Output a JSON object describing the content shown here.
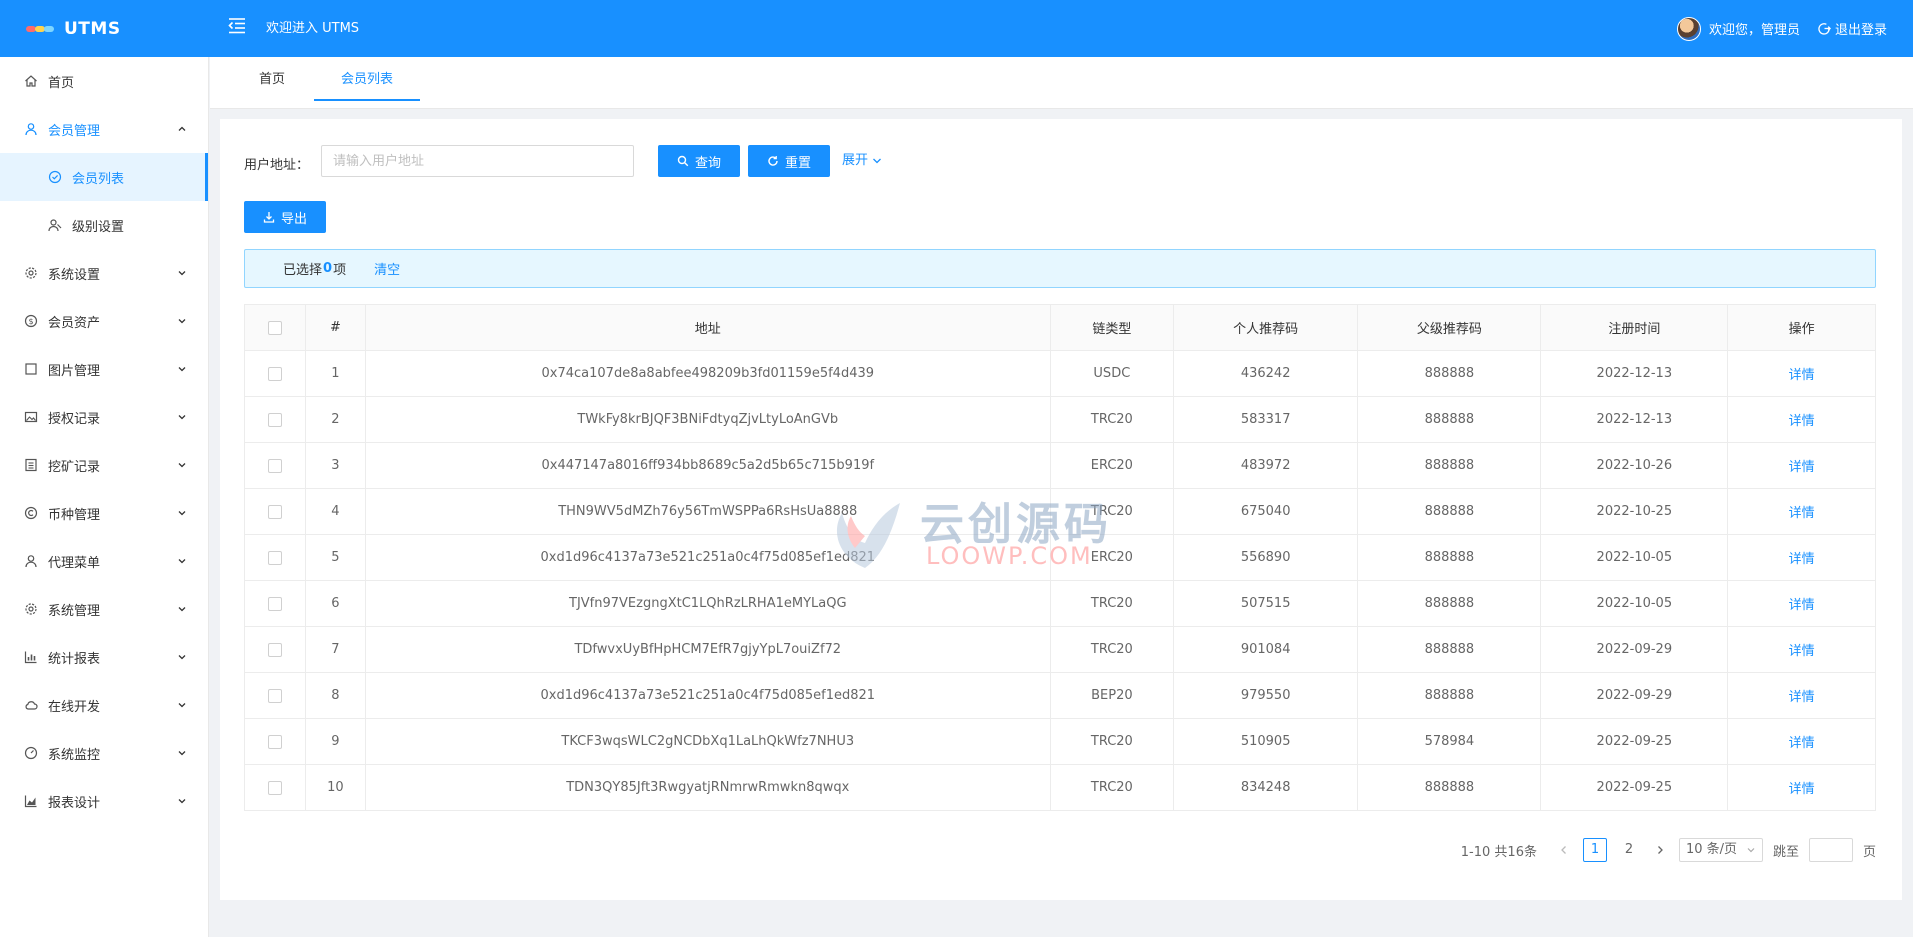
{
  "header": {
    "app_name": "UTMS",
    "welcome": "欢迎进入 UTMS",
    "user_greeting": "欢迎您，管理员",
    "logout": "退出登录",
    "brand_color": "#1890ff"
  },
  "sidebar": {
    "items": [
      {
        "label": "首页",
        "icon": "home-icon"
      },
      {
        "label": "会员管理",
        "icon": "user-icon",
        "open": true
      },
      {
        "label": "会员列表",
        "icon": "circle-check-icon",
        "sub": true,
        "active": true
      },
      {
        "label": "级别设置",
        "icon": "users-icon",
        "sub": true
      },
      {
        "label": "系统设置",
        "icon": "gear-icon"
      },
      {
        "label": "会员资产",
        "icon": "dollar-icon"
      },
      {
        "label": "图片管理",
        "icon": "square-icon"
      },
      {
        "label": "授权记录",
        "icon": "image-icon"
      },
      {
        "label": "挖矿记录",
        "icon": "list-icon"
      },
      {
        "label": "币种管理",
        "icon": "copyright-icon"
      },
      {
        "label": "代理菜单",
        "icon": "user-icon"
      },
      {
        "label": "系统管理",
        "icon": "gear-icon"
      },
      {
        "label": "统计报表",
        "icon": "bar-chart-icon"
      },
      {
        "label": "在线开发",
        "icon": "cloud-icon"
      },
      {
        "label": "系统监控",
        "icon": "dashboard-icon"
      },
      {
        "label": "报表设计",
        "icon": "area-chart-icon"
      }
    ]
  },
  "tabs": {
    "home": "首页",
    "active": "会员列表"
  },
  "search": {
    "label": "用户地址：",
    "placeholder": "请输入用户地址",
    "value": "",
    "query": "查询",
    "reset": "重置",
    "expand": "展开"
  },
  "toolbar": {
    "export": "导出"
  },
  "selection": {
    "prefix": "已选择",
    "count": "0",
    "suffix": "项",
    "clear": "清空"
  },
  "table": {
    "columns": [
      "#",
      "地址",
      "链类型",
      "个人推荐码",
      "父级推荐码",
      "注册时间",
      "操作"
    ],
    "rows": [
      {
        "idx": "1",
        "address": "0x74ca107de8a8abfee498209b3fd01159e5f4d439",
        "chain": "USDC",
        "code": "436242",
        "parent": "888888",
        "date": "2022-12-13",
        "action": "详情"
      },
      {
        "idx": "2",
        "address": "TWkFy8krBJQF3BNiFdtyqZjvLtyLoAnGVb",
        "chain": "TRC20",
        "code": "583317",
        "parent": "888888",
        "date": "2022-12-13",
        "action": "详情"
      },
      {
        "idx": "3",
        "address": "0x447147a8016ff934bb8689c5a2d5b65c715b919f",
        "chain": "ERC20",
        "code": "483972",
        "parent": "888888",
        "date": "2022-10-26",
        "action": "详情"
      },
      {
        "idx": "4",
        "address": "THN9WV5dMZh76y56TmWSPPa6RsHsUa8888",
        "chain": "TRC20",
        "code": "675040",
        "parent": "888888",
        "date": "2022-10-25",
        "action": "详情"
      },
      {
        "idx": "5",
        "address": "0xd1d96c4137a73e521c251a0c4f75d085ef1ed821",
        "chain": "ERC20",
        "code": "556890",
        "parent": "888888",
        "date": "2022-10-05",
        "action": "详情"
      },
      {
        "idx": "6",
        "address": "TJVfn97VEzgngXtC1LQhRzLRHA1eMYLaQG",
        "chain": "TRC20",
        "code": "507515",
        "parent": "888888",
        "date": "2022-10-05",
        "action": "详情"
      },
      {
        "idx": "7",
        "address": "TDfwvxUyBfHpHCM7EfR7gjyYpL7ouiZf72",
        "chain": "TRC20",
        "code": "901084",
        "parent": "888888",
        "date": "2022-09-29",
        "action": "详情"
      },
      {
        "idx": "8",
        "address": "0xd1d96c4137a73e521c251a0c4f75d085ef1ed821",
        "chain": "BEP20",
        "code": "979550",
        "parent": "888888",
        "date": "2022-09-29",
        "action": "详情"
      },
      {
        "idx": "9",
        "address": "TKCF3wqsWLC2gNCDbXq1LaLhQkWfz7NHU3",
        "chain": "TRC20",
        "code": "510905",
        "parent": "578984",
        "date": "2022-09-25",
        "action": "详情"
      },
      {
        "idx": "10",
        "address": "TDN3QY85Jft3RwgyatjRNmrwRmwkn8qwqx",
        "chain": "TRC20",
        "code": "834248",
        "parent": "888888",
        "date": "2022-09-25",
        "action": "详情"
      }
    ]
  },
  "pagination": {
    "total": "1-10 共16条",
    "pages": [
      "1",
      "2"
    ],
    "current": "1",
    "page_size": "10 条/页",
    "jump_prefix": "跳至",
    "jump_suffix": "页"
  },
  "watermark": {
    "line1": "云创源码",
    "line2": "LOOWP.COM"
  }
}
